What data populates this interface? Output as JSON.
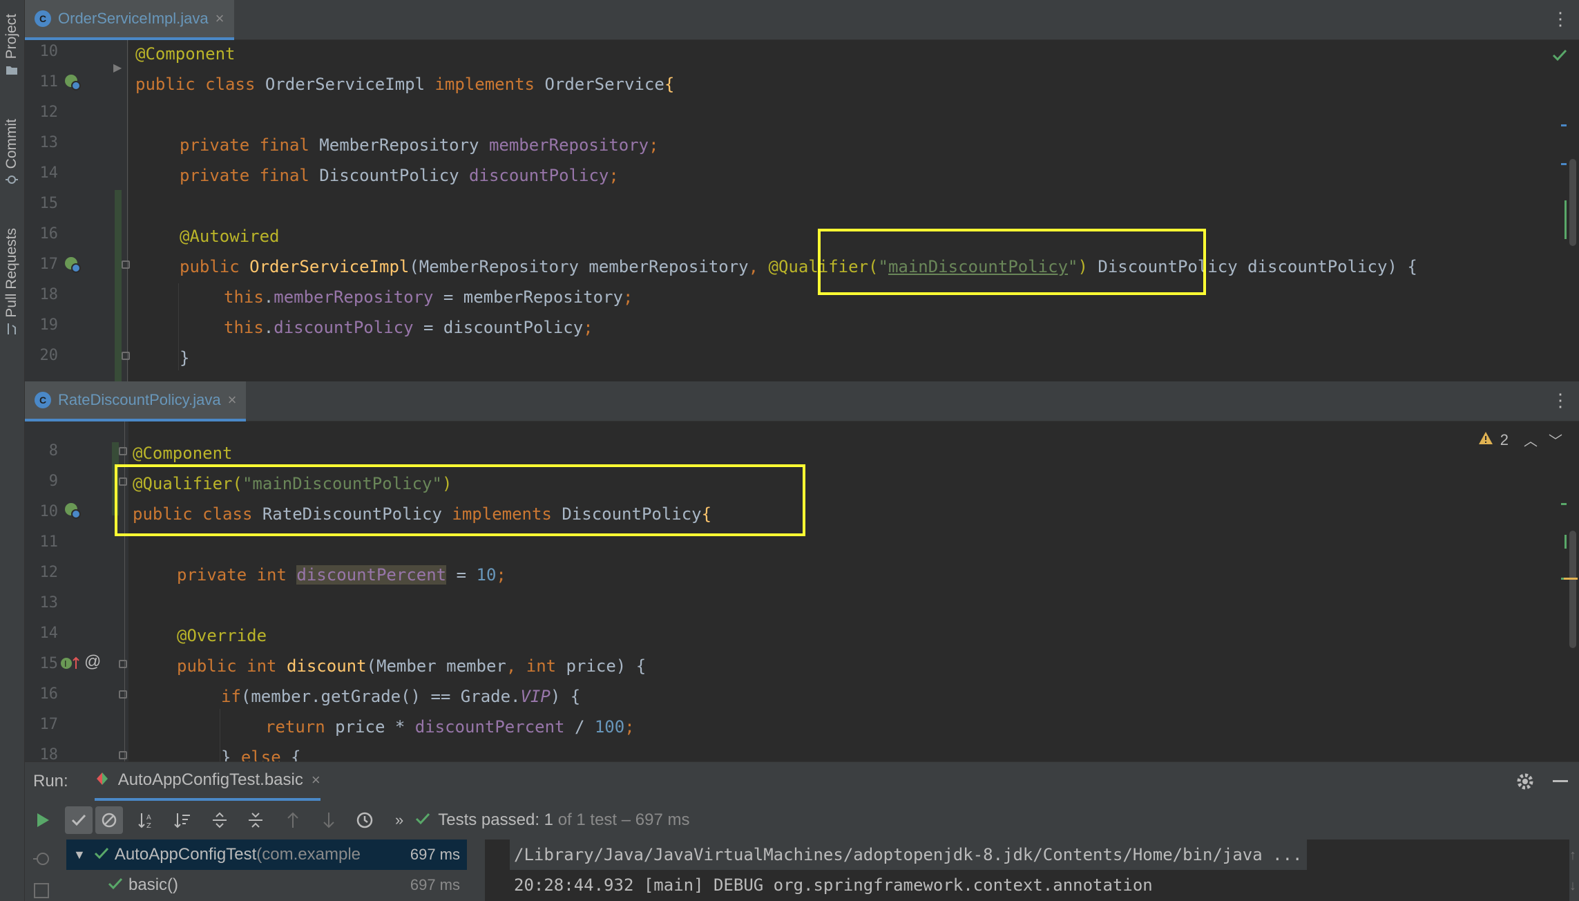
{
  "tool_window_tabs": [
    {
      "label": "Project",
      "icon": "folder-icon"
    },
    {
      "label": "Commit",
      "icon": "commit-icon"
    },
    {
      "label": "Pull Requests",
      "icon": "pull-request-icon"
    }
  ],
  "top_editor": {
    "tab": {
      "icon_letter": "C",
      "label": "OrderServiceImpl.java",
      "close": "×"
    },
    "line_numbers": [
      "10",
      "11",
      "12",
      "13",
      "14",
      "15",
      "16",
      "17",
      "18",
      "19",
      "20"
    ],
    "tokens": {
      "l10_ann": "@Component",
      "l11_kw1": "public class ",
      "l11_name": "OrderServiceImpl ",
      "l11_kw2": "implements ",
      "l11_iface": "OrderService",
      "l11_brace": "{",
      "l13_kw": "private final ",
      "l13_type": "MemberRepository ",
      "l13_field": "memberRepository",
      "l13_semi": ";",
      "l14_kw": "private final ",
      "l14_type": "DiscountPolicy ",
      "l14_field": "discountPolicy",
      "l14_semi": ";",
      "l16_ann": "@Autowired",
      "l17_kw": "public ",
      "l17_fn": "OrderServiceImpl",
      "l17_p1": "(MemberRepository memberRepository",
      "l17_comma": ", ",
      "l17_ann": "@Qualifier(",
      "l17_q1": "\"",
      "l17_str": "mainDiscountPolicy",
      "l17_q2": "\"",
      "l17_ann2": ") ",
      "l17_p2": "DiscountPolicy discountPolicy) {",
      "l18_this": "this",
      "l18_dot": ".",
      "l18_field": "memberRepository",
      "l18_rest": " = memberRepository",
      "l18_semi": ";",
      "l19_this": "this",
      "l19_dot": ".",
      "l19_field": "discountPolicy",
      "l19_rest": " = discountPolicy",
      "l19_semi": ";",
      "l20_brace": "}"
    }
  },
  "bottom_editor": {
    "tab": {
      "icon_letter": "C",
      "label": "RateDiscountPolicy.java",
      "close": "×"
    },
    "warnings": {
      "icon": "warning-icon",
      "count": "2"
    },
    "line_numbers": [
      "8",
      "9",
      "10",
      "11",
      "12",
      "13",
      "14",
      "15",
      "16",
      "17",
      "18"
    ],
    "tokens": {
      "l8_ann": "@Component",
      "l9_ann": "@Qualifier(",
      "l9_str": "\"mainDiscountPolicy\"",
      "l9_ann2": ")",
      "l10_kw1": "public class ",
      "l10_name": "RateDiscountPolicy ",
      "l10_kw2": "implements ",
      "l10_iface": "DiscountPolicy",
      "l10_brace": "{",
      "l12_kw": "private int ",
      "l12_field": "discountPercent",
      "l12_eq": " = ",
      "l12_num": "10",
      "l12_semi": ";",
      "l14_ann": "@Override",
      "l15_kw": "public int ",
      "l15_fn": "discount",
      "l15_p1": "(Member member",
      "l15_comma": ", ",
      "l15_kw2": "int ",
      "l15_p2": "price) {",
      "l16_kw": "if",
      "l16_p1": "(member.getGrade() == Grade.",
      "l16_vip": "VIP",
      "l16_p2": ") {",
      "l17_kw": "return ",
      "l17_p1": "price * ",
      "l17_field": "discountPercent",
      "l17_p2": " / ",
      "l17_num": "100",
      "l17_semi": ";",
      "l18_p1": "} ",
      "l18_kw": "else",
      "l18_p2": " {"
    }
  },
  "run_panel": {
    "label": "Run:",
    "config_name": "AutoAppConfigTest.basic",
    "close": "×",
    "status_prefix": "Tests passed: ",
    "status_count": "1",
    "status_suffix": " of 1 test – 697 ms",
    "more": "»",
    "tree": [
      {
        "name": "AutoAppConfigTest",
        "detail": " (com.example",
        "time": "697 ms"
      },
      {
        "name": "basic()",
        "time": "697 ms"
      }
    ],
    "console_lines": [
      "/Library/Java/JavaVirtualMachines/adoptopenjdk-8.jdk/Contents/Home/bin/java ...",
      "20:28:44.932 [main] DEBUG org.springframework.context.annotation"
    ]
  },
  "colors": {
    "keyword": "#cc7832",
    "annotation": "#bbb529",
    "field": "#9876aa",
    "function": "#ffc66d",
    "string": "#6a8759",
    "number": "#6897bb",
    "highlight_box": "#ffff33",
    "pass_green": "#59a869"
  }
}
